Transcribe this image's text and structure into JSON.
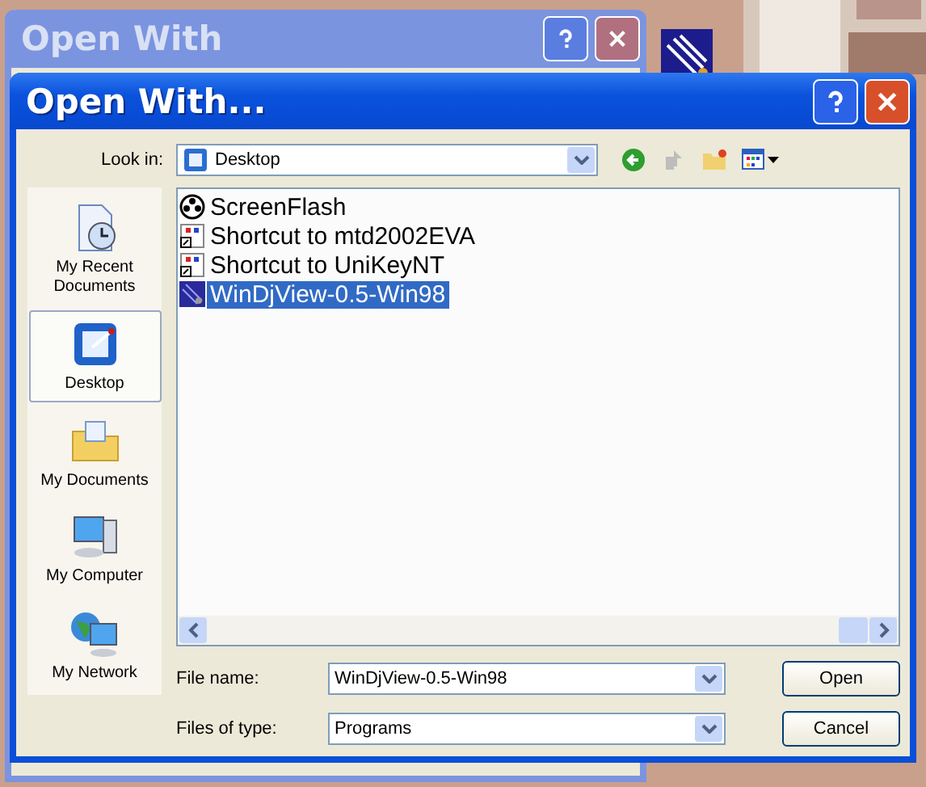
{
  "back_window": {
    "title": "Open With"
  },
  "dialog": {
    "title": "Open With..."
  },
  "look_in": {
    "label": "Look in:",
    "value": "Desktop"
  },
  "places": [
    {
      "label": "My Recent Documents",
      "kind": "recent",
      "selected": false
    },
    {
      "label": "Desktop",
      "kind": "desktop",
      "selected": true
    },
    {
      "label": "My Documents",
      "kind": "documents",
      "selected": false
    },
    {
      "label": "My Computer",
      "kind": "computer",
      "selected": false
    },
    {
      "label": "My Network",
      "kind": "network",
      "selected": false
    }
  ],
  "files": [
    {
      "name": "ScreenFlash",
      "kind": "flash",
      "selected": false
    },
    {
      "name": "Shortcut to mtd2002EVA",
      "kind": "shortcut",
      "selected": false
    },
    {
      "name": "Shortcut to UniKeyNT",
      "kind": "shortcut",
      "selected": false
    },
    {
      "name": "WinDjView-0.5-Win98",
      "kind": "app",
      "selected": true
    }
  ],
  "file_name": {
    "label": "File name:",
    "value": "WinDjView-0.5-Win98"
  },
  "file_type": {
    "label": "Files of type:",
    "value": "Programs"
  },
  "buttons": [
    "Open",
    "Cancel"
  ]
}
